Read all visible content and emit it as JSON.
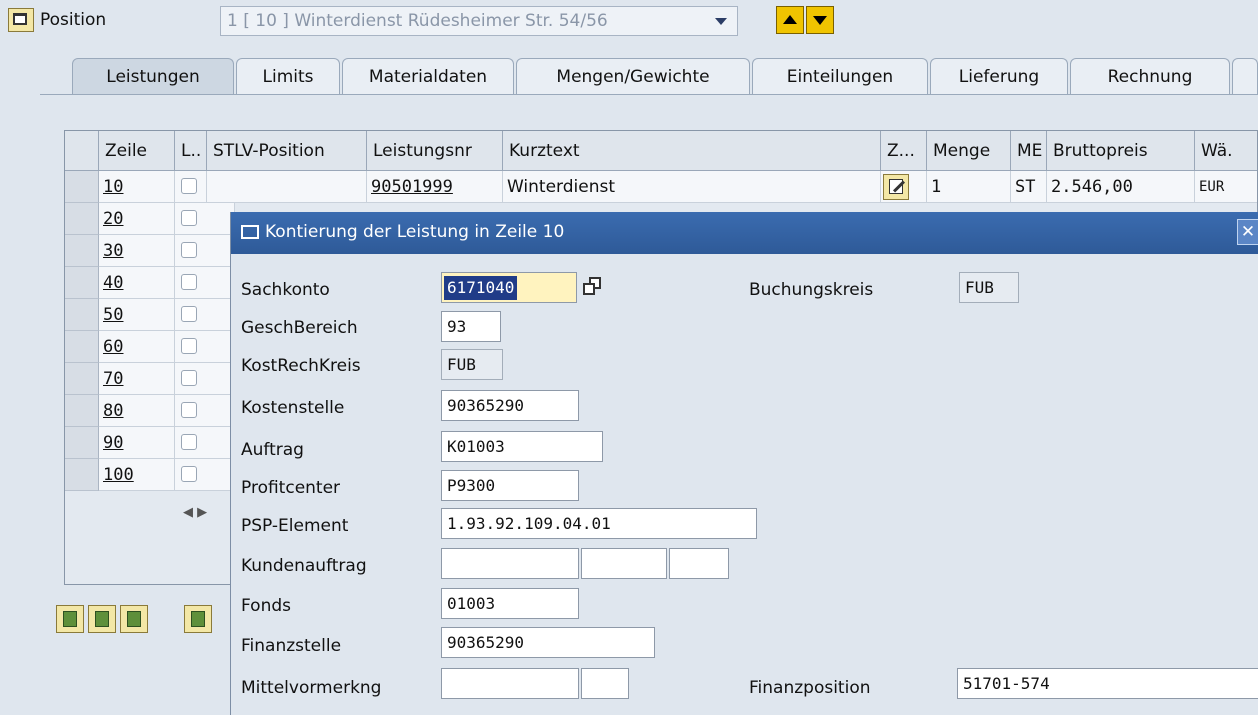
{
  "header": {
    "label": "Position",
    "selected_position": "1 [ 10 ] Winterdienst Rüdesheimer Str. 54/56"
  },
  "tabs": [
    "Leistungen",
    "Limits",
    "Materialdaten",
    "Mengen/Gewichte",
    "Einteilungen",
    "Lieferung",
    "Rechnung"
  ],
  "table": {
    "columns": [
      "Zeile",
      "L..",
      "STLV-Position",
      "Leistungsnr",
      "Kurztext",
      "Z...",
      "Menge",
      "ME",
      "Bruttopreis",
      "Wä."
    ],
    "rows": [
      {
        "zeile": "10",
        "leistungsnr": "90501999",
        "kurztext": "Winterdienst",
        "menge": "1",
        "me": "ST",
        "bruttopreis": "2.546,00",
        "waehrung": "EUR"
      },
      {
        "zeile": "20"
      },
      {
        "zeile": "30"
      },
      {
        "zeile": "40"
      },
      {
        "zeile": "50"
      },
      {
        "zeile": "60"
      },
      {
        "zeile": "70"
      },
      {
        "zeile": "80"
      },
      {
        "zeile": "90"
      },
      {
        "zeile": "100"
      }
    ]
  },
  "dialog": {
    "title": "Kontierung der Leistung in Zeile 10",
    "fields": {
      "sachkonto": {
        "label": "Sachkonto",
        "value": "6171040"
      },
      "buchungskreis": {
        "label": "Buchungskreis",
        "value": "FUB"
      },
      "geschbereich": {
        "label": "GeschBereich",
        "value": "93"
      },
      "kostrechkreis": {
        "label": "KostRechKreis",
        "value": "FUB"
      },
      "kostenstelle": {
        "label": "Kostenstelle",
        "value": "90365290"
      },
      "auftrag": {
        "label": "Auftrag",
        "value": "K01003"
      },
      "profitcenter": {
        "label": "Profitcenter",
        "value": "P9300"
      },
      "psp": {
        "label": "PSP-Element",
        "value": "1.93.92.109.04.01"
      },
      "kundenauftrag": {
        "label": "Kundenauftrag",
        "value": ""
      },
      "fonds": {
        "label": "Fonds",
        "value": "01003"
      },
      "finanzstelle": {
        "label": "Finanzstelle",
        "value": "90365290"
      },
      "mittelvormerkng": {
        "label": "Mittelvormerkng",
        "value": ""
      },
      "finanzposition": {
        "label": "Finanzposition",
        "value": "51701-574"
      }
    }
  }
}
